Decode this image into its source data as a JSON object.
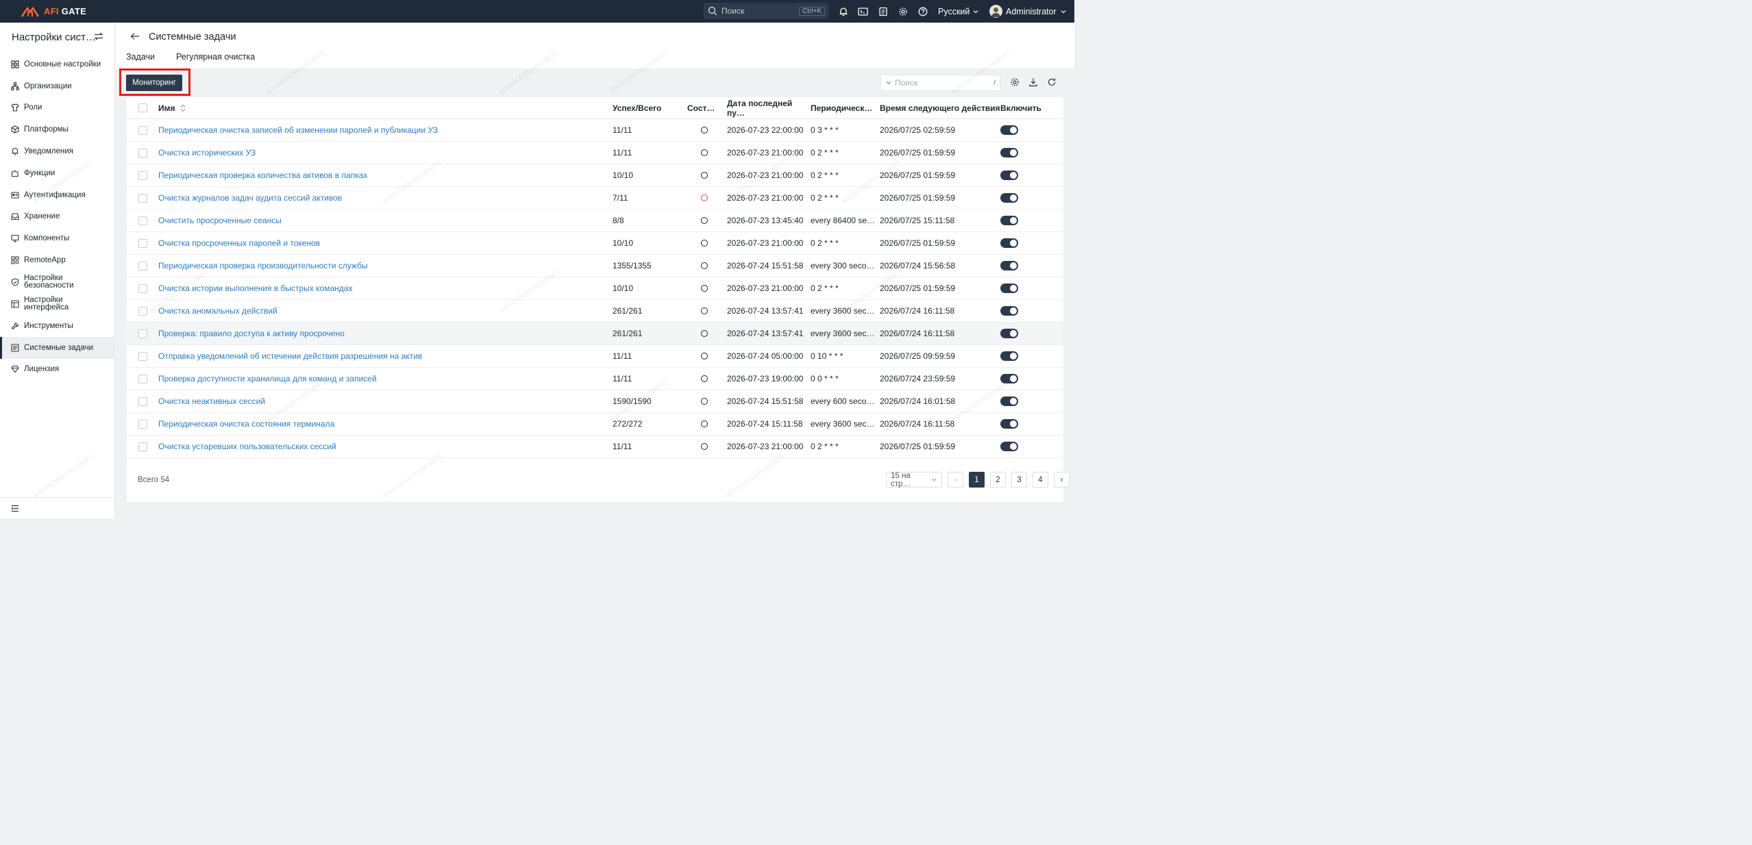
{
  "topbar": {
    "logo": "AFI GATE",
    "search_placeholder": "Поиск",
    "search_shortcut": "Ctrl+K",
    "icons": [
      "bell-icon",
      "terminal-icon",
      "clipboard-icon",
      "gear-icon",
      "help-icon"
    ],
    "language": "Русский",
    "user": "Administrator"
  },
  "sidebar": {
    "title": "Настройки сист…",
    "items": [
      {
        "label": "Основные настройки",
        "icon": "grid-icon"
      },
      {
        "label": "Организации",
        "icon": "org-icon"
      },
      {
        "label": "Роли",
        "icon": "shirt-icon"
      },
      {
        "label": "Платформы",
        "icon": "cube-icon"
      },
      {
        "label": "Уведомления",
        "icon": "bell-icon"
      },
      {
        "label": "Функции",
        "icon": "puzzle-icon"
      },
      {
        "label": "Аутентификация",
        "icon": "id-card-icon"
      },
      {
        "label": "Хранение",
        "icon": "inbox-icon"
      },
      {
        "label": "Компоненты",
        "icon": "monitor-icon"
      },
      {
        "label": "RemoteApp",
        "icon": "apps-icon"
      },
      {
        "label": "Настройки безопасности",
        "icon": "shield-icon"
      },
      {
        "label": "Настройки интерфейса",
        "icon": "layout-icon"
      },
      {
        "label": "Инструменты",
        "icon": "tools-icon"
      },
      {
        "label": "Системные задачи",
        "icon": "tasks-icon"
      },
      {
        "label": "Лицензия",
        "icon": "diamond-icon"
      }
    ],
    "active": "Системные задачи"
  },
  "page": {
    "title": "Системные задачи",
    "tabs": [
      "Задачи",
      "Регулярная очистка"
    ]
  },
  "toolbar": {
    "monitor_label": "Мониторинг",
    "search_placeholder": "Поиск",
    "search_shortcut": "/"
  },
  "table": {
    "headers": {
      "name": "Имя",
      "success": "Успех/Всего",
      "state": "Сост…",
      "last_run": "Дата последней пу…",
      "periodic": "Периодическ…",
      "next": "Время следующего действия",
      "enabled": "Включить"
    },
    "rows": [
      {
        "name": "Периодическая очистка записей об изменении паролей и публикации УЗ",
        "success": "11/11",
        "state": "ok",
        "last_run": "2026-07-23 22:00:00",
        "periodic": "0 3 * * *",
        "next": "2026/07/25 02:59:59",
        "enabled": true
      },
      {
        "name": "Очистка исторических УЗ",
        "success": "11/11",
        "state": "ok",
        "last_run": "2026-07-23 21:00:00",
        "periodic": "0 2 * * *",
        "next": "2026/07/25 01:59:59",
        "enabled": true
      },
      {
        "name": "Периодическая проверка количества активов в папках",
        "success": "10/10",
        "state": "ok",
        "last_run": "2026-07-23 21:00:00",
        "periodic": "0 2 * * *",
        "next": "2026/07/25 01:59:59",
        "enabled": true
      },
      {
        "name": "Очистка журналов задач аудита сессий активов",
        "success": "7/11",
        "state": "error",
        "last_run": "2026-07-23 21:00:00",
        "periodic": "0 2 * * *",
        "next": "2026/07/25 01:59:59",
        "enabled": true
      },
      {
        "name": "Очистить просроченные сеансы",
        "success": "8/8",
        "state": "ok",
        "last_run": "2026-07-23 13:45:40",
        "periodic": "every 86400 se…",
        "next": "2026/07/25 15:11:58",
        "enabled": true
      },
      {
        "name": "Очистка просроченных паролей и токенов",
        "success": "10/10",
        "state": "ok",
        "last_run": "2026-07-23 21:00:00",
        "periodic": "0 2 * * *",
        "next": "2026/07/25 01:59:59",
        "enabled": true
      },
      {
        "name": "Периодическая проверка производительности службы",
        "success": "1355/1355",
        "state": "ok",
        "last_run": "2026-07-24 15:51:58",
        "periodic": "every 300 seco…",
        "next": "2026/07/24 15:56:58",
        "enabled": true
      },
      {
        "name": "Очистка истории выполнения в быстрых командах",
        "success": "10/10",
        "state": "ok",
        "last_run": "2026-07-23 21:00:00",
        "periodic": "0 2 * * *",
        "next": "2026/07/25 01:59:59",
        "enabled": true
      },
      {
        "name": "Очистка аномальных действий",
        "success": "261/261",
        "state": "ok",
        "last_run": "2026-07-24 13:57:41",
        "periodic": "every 3600 sec…",
        "next": "2026/07/24 16:11:58",
        "enabled": true
      },
      {
        "name": "Проверка: правило доступа к активу просрочено",
        "success": "261/261",
        "state": "ok",
        "last_run": "2026-07-24 13:57:41",
        "periodic": "every 3600 sec…",
        "next": "2026/07/24 16:11:58",
        "enabled": true
      },
      {
        "name": "Отправка уведомлений об истечении действия разрешения на актив",
        "success": "11/11",
        "state": "ok",
        "last_run": "2026-07-24 05:00:00",
        "periodic": "0 10 * * *",
        "next": "2026/07/25 09:59:59",
        "enabled": true
      },
      {
        "name": "Проверка доступности хранилища для команд и записей",
        "success": "11/11",
        "state": "ok",
        "last_run": "2026-07-23 19:00:00",
        "periodic": "0 0 * * *",
        "next": "2026/07/24 23:59:59",
        "enabled": true
      },
      {
        "name": "Очистка неактивных сессий",
        "success": "1590/1590",
        "state": "ok",
        "last_run": "2026-07-24 15:51:58",
        "periodic": "every 600 seco…",
        "next": "2026/07/24 16:01:58",
        "enabled": true
      },
      {
        "name": "Периодическая очистка состояния терминала",
        "success": "272/272",
        "state": "ok",
        "last_run": "2026-07-24 15:11:58",
        "periodic": "every 3600 sec…",
        "next": "2026/07/24 16:11:58",
        "enabled": true
      },
      {
        "name": "Очистка устаревших пользовательских сессий",
        "success": "11/11",
        "state": "ok",
        "last_run": "2026-07-23 21:00:00",
        "periodic": "0 2 * * *",
        "next": "2026/07/25 01:59:59",
        "enabled": true
      }
    ]
  },
  "footer": {
    "total": "Всего 54",
    "page_size": "15 на стр…",
    "pages": [
      "1",
      "2",
      "3",
      "4"
    ],
    "current_page": "1",
    "prev": "‹",
    "next": "›"
  },
  "watermark": "admin(Administrator)",
  "colors": {
    "topbar": "#1f2a3a",
    "accent": "#2c3a4d",
    "link": "#2b7bc0",
    "highlight": "#e0201f",
    "logo": "#ff6a2b"
  }
}
